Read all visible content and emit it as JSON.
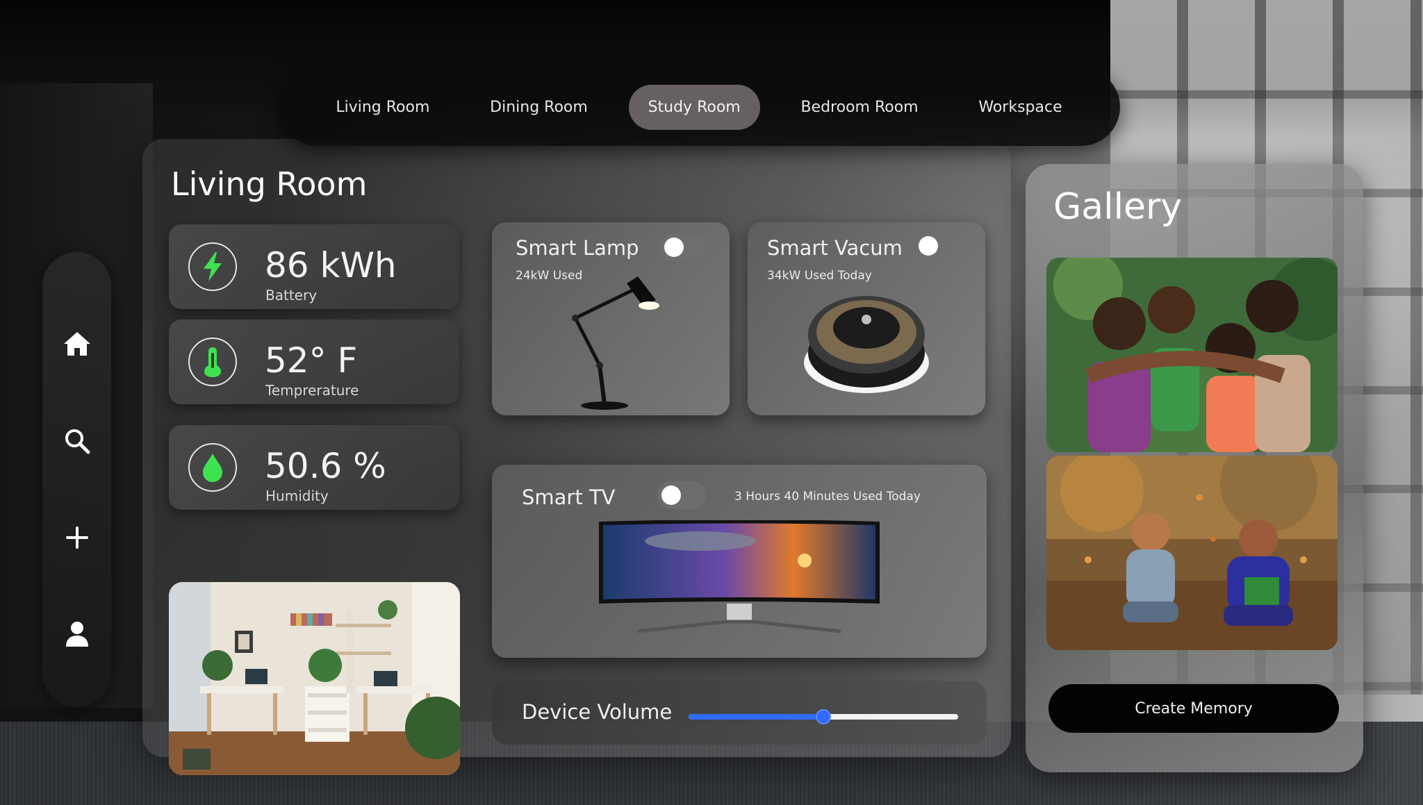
{
  "room_tabs": [
    {
      "label": "Living Room",
      "active": false
    },
    {
      "label": "Dining Room",
      "active": false
    },
    {
      "label": "Study Room",
      "active": true
    },
    {
      "label": "Bedroom Room",
      "active": false
    },
    {
      "label": "Workspace",
      "active": false
    }
  ],
  "side_nav": {
    "items": [
      {
        "icon": "home-icon"
      },
      {
        "icon": "search-icon"
      },
      {
        "icon": "plus-icon"
      },
      {
        "icon": "user-icon"
      }
    ]
  },
  "page": {
    "title": "Living Room"
  },
  "stats": [
    {
      "icon": "lightning-icon",
      "value": "86 kWh",
      "label": "Battery"
    },
    {
      "icon": "thermometer-icon",
      "value": "52° F",
      "label": "Temprerature"
    },
    {
      "icon": "water-drop-icon",
      "value": "50.6 %",
      "label": "Humidity"
    }
  ],
  "devices": {
    "lamp": {
      "name": "Smart Lamp",
      "usage": "24kW Used",
      "on": false
    },
    "vacuum": {
      "name": "Smart Vacum",
      "usage": "34kW Used Today",
      "on": false
    },
    "tv": {
      "name": "Smart TV",
      "usage": "3 Hours 40 Minutes Used Today",
      "on": false
    }
  },
  "volume": {
    "label": "Device Volume",
    "level": 0.5
  },
  "gallery": {
    "title": "Gallery",
    "create_label": "Create Memory"
  },
  "colors": {
    "accent": "#2f6bff",
    "icon_green": "#3ee24f",
    "tab_active": "#787070"
  }
}
